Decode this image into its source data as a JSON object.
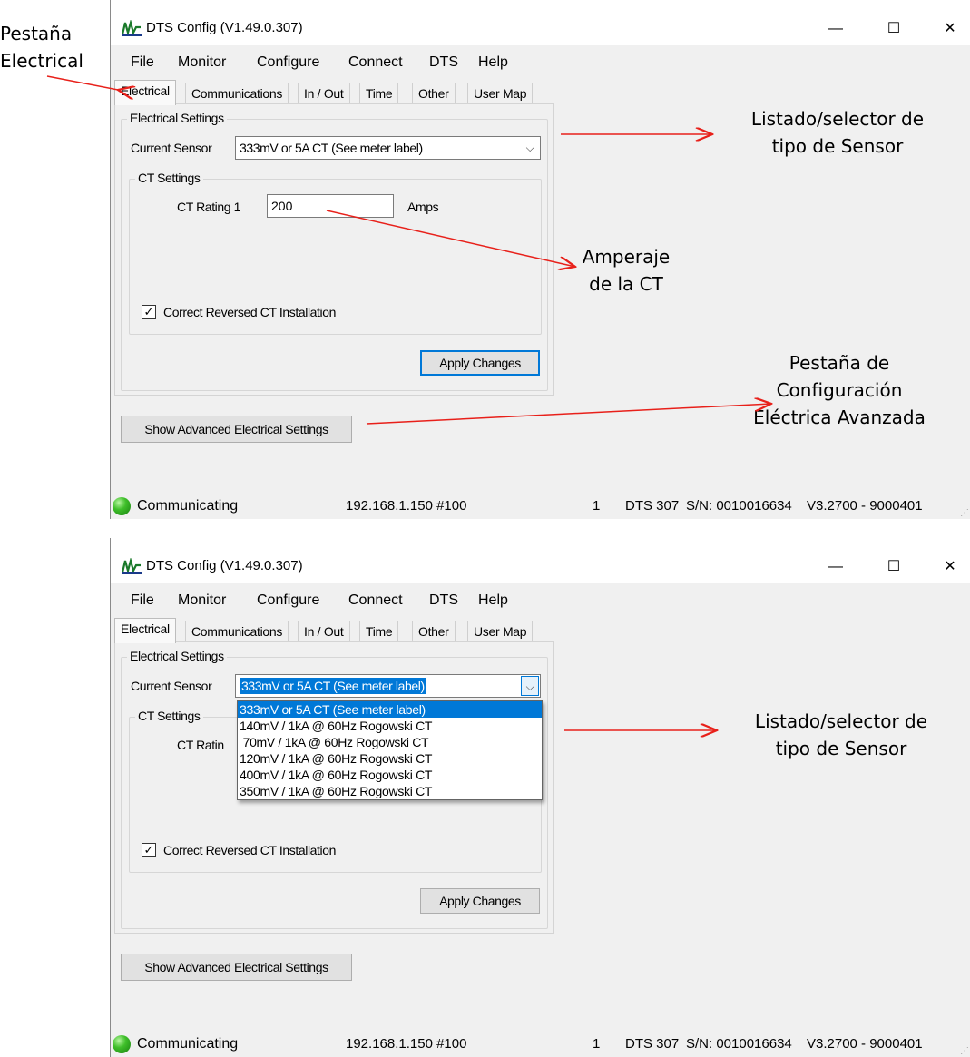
{
  "window": {
    "title": "DTS Config (V1.49.0.307)",
    "minimize_glyph": "—",
    "maximize_glyph": "☐",
    "close_glyph": "✕"
  },
  "menu": [
    "File",
    "Monitor",
    "Configure",
    "Connect",
    "DTS",
    "Help"
  ],
  "tabs": [
    "Electrical",
    "Communications",
    "In / Out",
    "Time",
    "Other",
    "User Map"
  ],
  "electrical": {
    "group_title": "Electrical Settings",
    "current_sensor_label": "Current Sensor",
    "current_sensor_value": "333mV or 5A CT (See meter label)",
    "ct_group_title": "CT Settings",
    "ct_rating_label": "CT Rating 1",
    "ct_rating_label_partial": "CT Ratin",
    "ct_rating_value": "200",
    "amps_label": "Amps",
    "correct_reversed_label": "Correct Reversed CT Installation",
    "correct_reversed_checked": true,
    "apply_button": "Apply Changes",
    "advanced_button": "Show Advanced Electrical Settings"
  },
  "sensor_options": [
    "333mV or 5A CT (See meter label)",
    "140mV / 1kA @ 60Hz Rogowski CT",
    " 70mV / 1kA @ 60Hz Rogowski CT",
    "120mV / 1kA @ 60Hz Rogowski CT",
    "400mV / 1kA @ 60Hz Rogowski CT",
    "350mV / 1kA @ 60Hz Rogowski CT"
  ],
  "status": {
    "state": "Communicating",
    "address": "192.168.1.150 #100",
    "index": "1",
    "device": "DTS 307",
    "serial": "S/N: 0010016634",
    "version": "V3.2700 - 9000401"
  },
  "annotations": {
    "tab_electrical": [
      "Pestaña",
      "Electrical"
    ],
    "sensor_selector": [
      "Listado/selector de",
      "tipo de Sensor"
    ],
    "ct_amperage": [
      "Amperaje",
      "de la CT"
    ],
    "advanced_tab": [
      "Pestaña de",
      "Configuración",
      "Eléctrica Avanzada"
    ],
    "sensor_selector_2": [
      "Listado/selector de",
      "tipo de Sensor"
    ]
  },
  "colors": {
    "window_bg": "#f0f0f0",
    "selection_blue": "#0078d7",
    "arrow_red": "#e8201a",
    "status_led": "#3fbf2a"
  }
}
